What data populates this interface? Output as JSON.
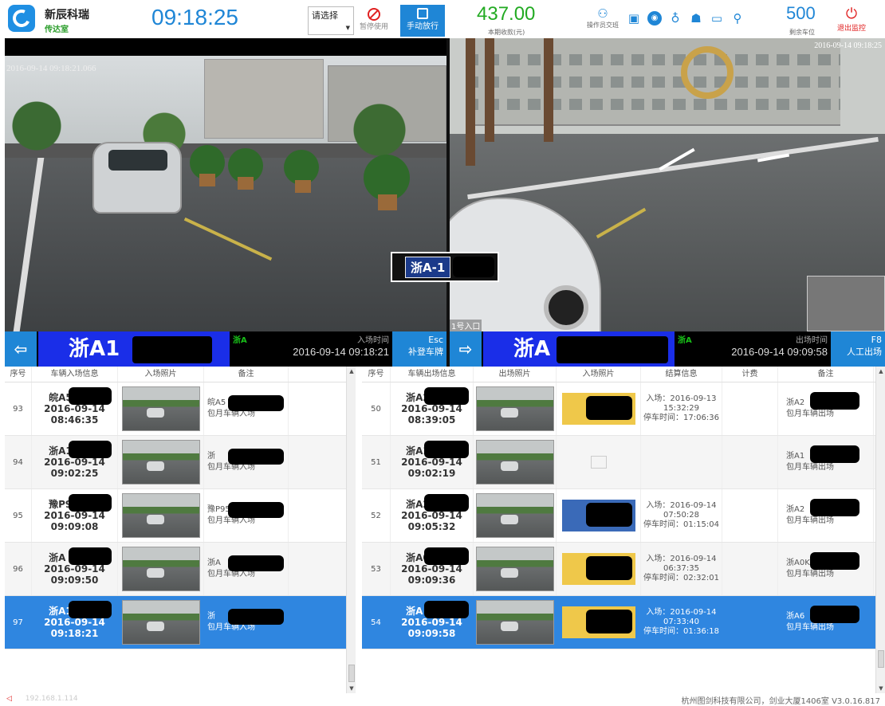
{
  "header": {
    "company": "新辰科瑞",
    "station": "传达室",
    "clock": "09:18:25",
    "select_value": "请选择",
    "pause_label": "暂停使用",
    "manual_release_label": "手动放行",
    "income": "437.00",
    "income_label": "本期收款(元)",
    "shift_label": "操作员交班",
    "remaining_spots": "500",
    "remaining_spots_label": "剩余车位",
    "exit_label": "退出监控",
    "accent_color": "#1f86d6",
    "tool_icons": [
      "document-icon",
      "camera-icon",
      "money-bag-icon",
      "person-icon",
      "monitor-icon",
      "wrench-icon"
    ]
  },
  "camera_in": {
    "timestamp": "2016-09-14 09:18:21.066",
    "plate_crop": "浙A-1"
  },
  "camera_out": {
    "timestamp": "2016-09-14 09:18:25",
    "name": "1号入口"
  },
  "entry_bar": {
    "plate": "浙A1",
    "green_text": "浙A",
    "time_label": "入场时间",
    "time": "2016-09-14 09:18:21",
    "key": "Esc",
    "button_label": "补登车牌"
  },
  "exit_bar": {
    "plate": "浙A",
    "green_text": "浙A",
    "time_label": "出场时间",
    "time": "2016-09-14 09:09:58",
    "key": "F8",
    "button_label": "人工出场"
  },
  "entry_table": {
    "headers": [
      "序号",
      "车辆入场信息",
      "入场照片",
      "备注"
    ],
    "rows": [
      {
        "no": "93",
        "plate": "皖A51",
        "date": "2016-09-14",
        "time": "08:46:35",
        "note1": "皖A5",
        "note2": "包月车辆入场"
      },
      {
        "no": "94",
        "plate": "浙A1",
        "date": "2016-09-14",
        "time": "09:02:25",
        "note1": "浙",
        "note2": "包月车辆入场"
      },
      {
        "no": "95",
        "plate": "豫P95",
        "date": "2016-09-14",
        "time": "09:09:08",
        "note1": "豫P95",
        "note2": "包月车辆入场"
      },
      {
        "no": "96",
        "plate": "浙A",
        "date": "2016-09-14",
        "time": "09:09:50",
        "note1": "浙A",
        "note2": "包月车辆入场"
      },
      {
        "no": "97",
        "plate": "浙A13",
        "date": "2016-09-14",
        "time": "09:18:21",
        "note1": "浙",
        "note2": "包月车辆入场"
      }
    ]
  },
  "exit_table": {
    "headers": [
      "序号",
      "车辆出场信息",
      "出场照片",
      "入场照片",
      "结算信息",
      "计费",
      "备注"
    ],
    "rows": [
      {
        "no": "50",
        "plate": "浙A2",
        "date": "2016-09-14",
        "time": "08:39:05",
        "s1": "入场：2016-09-13",
        "s2": "15:32:29",
        "s3": "停车时间：17:06:36",
        "note1": "浙A2",
        "note2": "包月车辆出场",
        "entry_photo": "plate"
      },
      {
        "no": "51",
        "plate": "浙A1",
        "date": "2016-09-14",
        "time": "09:02:19",
        "s1": "",
        "s2": "",
        "s3": "",
        "note1": "浙A1",
        "note2": "包月车辆出场",
        "entry_photo": "none"
      },
      {
        "no": "52",
        "plate": "浙A2",
        "date": "2016-09-14",
        "time": "09:05:32",
        "s1": "入场：2016-09-14",
        "s2": "07:50:28",
        "s3": "停车时间：01:15:04",
        "note1": "浙A2",
        "note2": "包月车辆出场",
        "entry_photo": "plate-blue"
      },
      {
        "no": "53",
        "plate": "浙A0",
        "date": "2016-09-14",
        "time": "09:09:36",
        "s1": "入场：2016-09-14",
        "s2": "06:37:35",
        "s3": "停车时间：02:32:01",
        "note1": "浙A0K",
        "note2": "包月车辆出场",
        "entry_photo": "plate"
      },
      {
        "no": "54",
        "plate": "浙A",
        "date": "2016-09-14",
        "time": "09:09:58",
        "s1": "入场：2016-09-14",
        "s2": "07:33:40",
        "s3": "停车时间：01:36:18",
        "note1": "浙A6",
        "note2": "包月车辆出场",
        "entry_photo": "plate"
      }
    ]
  },
  "footer": {
    "ip": "192.168.1.114",
    "copyright": "杭州图剑科技有限公司，剑业大厦1406室 V3.0.16.817"
  }
}
